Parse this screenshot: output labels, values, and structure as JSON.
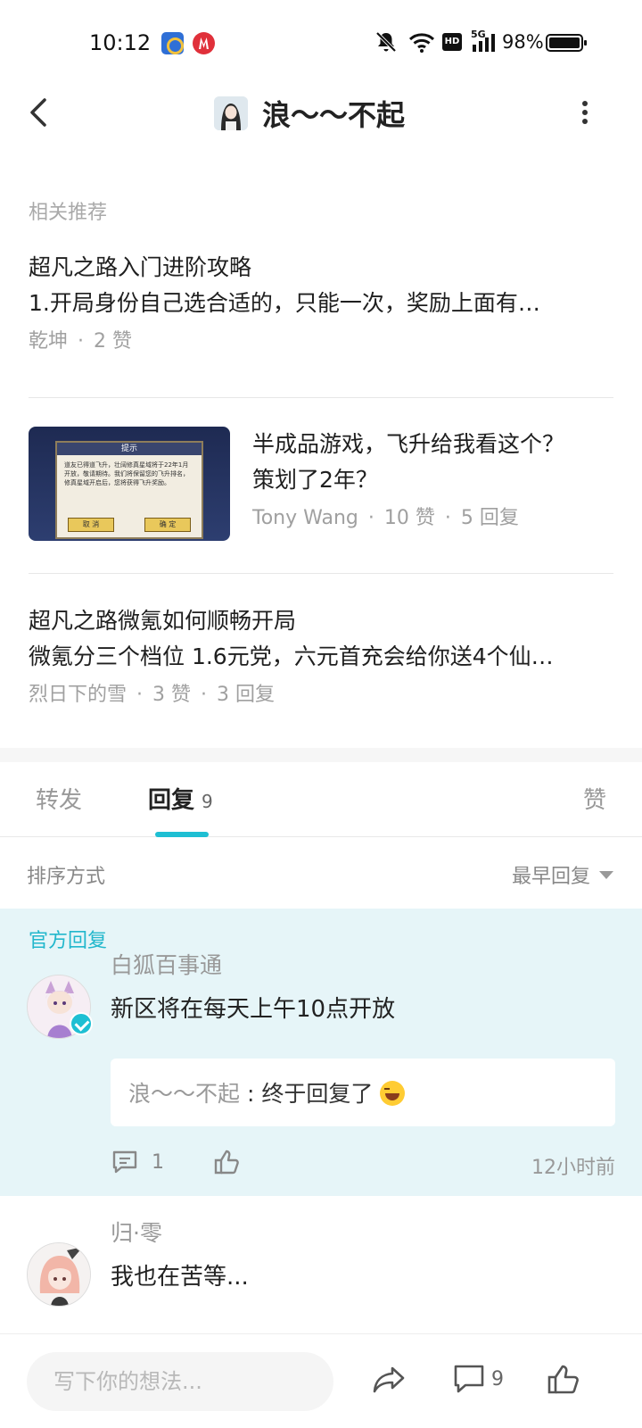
{
  "status_bar": {
    "time": "10:12",
    "network": "5G",
    "hd": "HD",
    "battery": "98%"
  },
  "header": {
    "title": "浪～～不起"
  },
  "related": {
    "label": "相关推荐",
    "items": [
      {
        "title": "超凡之路入门进阶攻略",
        "excerpt": "1.开局身份自己选合适的，只能一次，奖励上面有…",
        "author": "乾坤",
        "likes": "2 赞"
      },
      {
        "title_line1": "半成品游戏，飞升给我看这个？",
        "title_line2": "策划了2年？",
        "author": "Tony Wang",
        "likes": "10 赞",
        "replies": "5 回复",
        "thumb": {
          "dialog_title": "提示",
          "dialog_text": "道友已得道飞升，壮阔修真星域将于22年1月开放，敬请期待。我们将保留您的飞升排名，修真星域开启后，您将获得飞升奖励。",
          "cancel": "取 消",
          "confirm": "确 定"
        }
      },
      {
        "title": "超凡之路微氪如何顺畅开局",
        "excerpt": "微氪分三个档位 1.6元党，六元首充会给你送4个仙…",
        "author": "烈日下的雪",
        "likes": "3 赞",
        "replies": "3 回复"
      }
    ],
    "dot": "·"
  },
  "tabs": {
    "forward": "转发",
    "reply": "回复",
    "reply_count": "9",
    "like": "赞"
  },
  "sort": {
    "label": "排序方式",
    "value": "最早回复"
  },
  "official_reply": {
    "label": "官方回复",
    "username": "白狐百事通",
    "text": "新区将在每天上午10点开放",
    "quote_user": "浪～～不起",
    "quote_sep": ":",
    "quote_text": "终于回复了",
    "reply_count": "1",
    "time": "12小时前"
  },
  "comment2": {
    "username": "归·零",
    "text": "我也在苦等..."
  },
  "bottom_bar": {
    "placeholder": "写下你的想法...",
    "comment_count": "9"
  },
  "colors": {
    "accent": "#1ebfd3",
    "official_bg": "#e6f5f8"
  },
  "icons": [
    "back-arrow-icon",
    "more-vertical-icon",
    "comment-icon",
    "thumbs-up-icon",
    "share-icon",
    "dropdown-caret-icon",
    "verified-badge-icon"
  ]
}
